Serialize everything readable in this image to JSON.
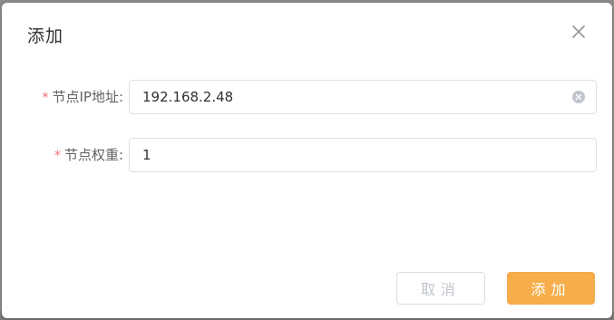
{
  "dialog": {
    "title": "添加",
    "close_icon": "close-icon"
  },
  "form": {
    "ip_field": {
      "label": "节点IP地址:",
      "required_mark": "*",
      "value": "192.168.2.48",
      "clear_icon": "clear-circle-icon"
    },
    "weight_field": {
      "label": "节点权重:",
      "required_mark": "*",
      "value": "1"
    }
  },
  "footer": {
    "cancel_label": "取消",
    "add_label": "添加"
  },
  "colors": {
    "required": "#f56c6c",
    "primary_button": "#f7ad49",
    "cancel_text": "#c0c4cc",
    "border": "#dcdfe6"
  }
}
